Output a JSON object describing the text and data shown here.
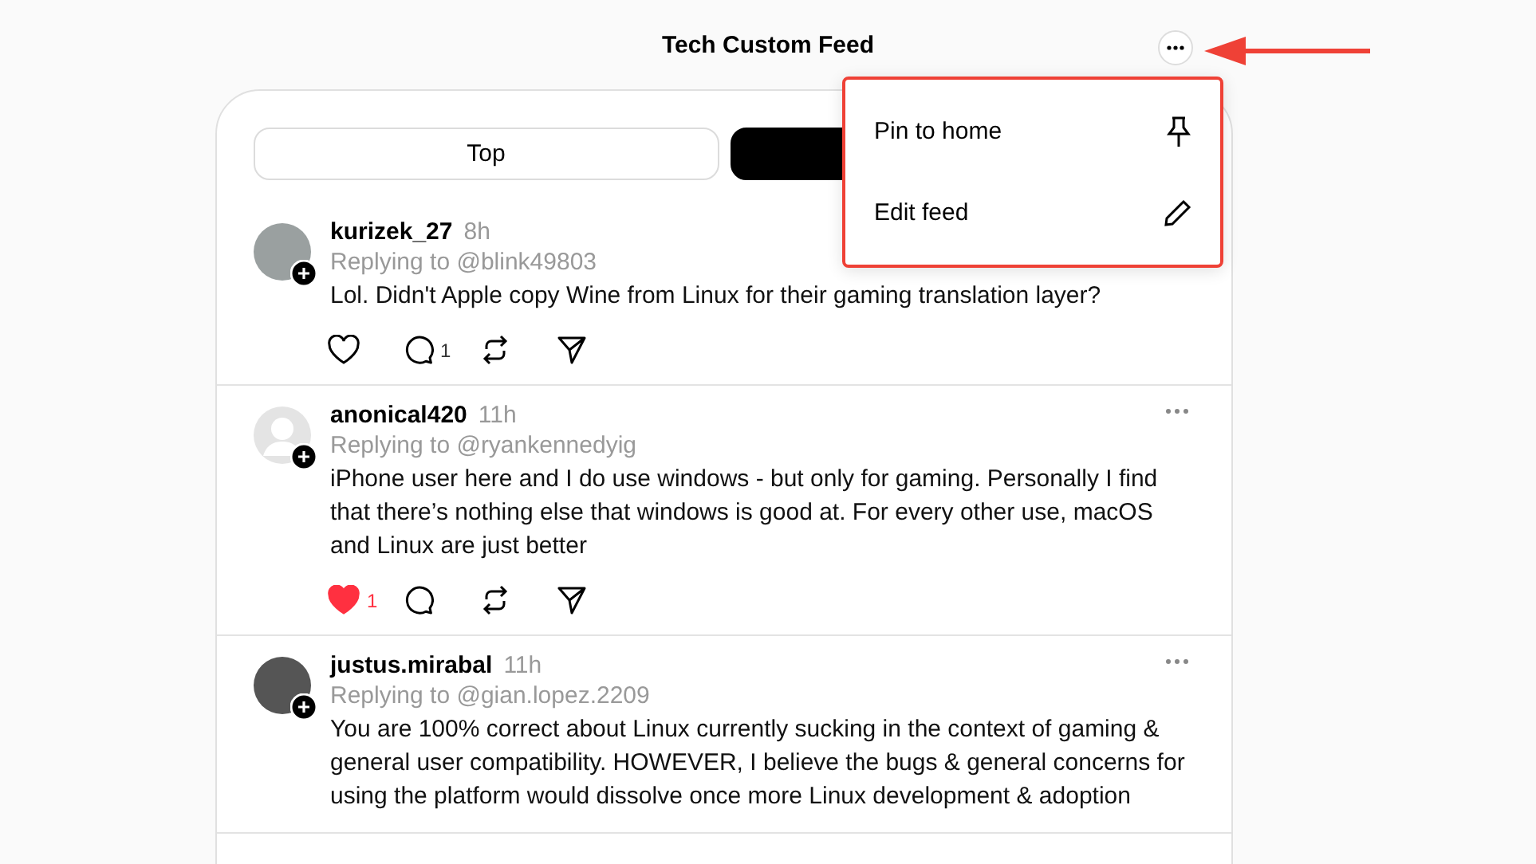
{
  "header": {
    "title": "Tech Custom Feed"
  },
  "tabs": [
    {
      "label": "Top",
      "selected": false
    },
    {
      "selected": true
    }
  ],
  "posts": [
    {
      "avatar": {
        "kind": "photo"
      },
      "username": "kurizek_27",
      "time": "8h",
      "replying_to": "Replying to @blink49803",
      "text": "Lol. Didn't Apple copy Wine from Linux for their gaming translation layer?",
      "actions": {
        "liked": false,
        "reply_count": "1"
      }
    },
    {
      "avatar": {
        "kind": "default"
      },
      "username": "anonical420",
      "time": "11h",
      "replying_to": "Replying to @ryankennedyig",
      "text": "iPhone user here and I do use windows - but only for gaming. Personally I find that there’s nothing else that windows is good at. For every other use, macOS and Linux are just better",
      "actions": {
        "liked": true,
        "like_count": "1"
      }
    },
    {
      "avatar": {
        "kind": "photo"
      },
      "username": "justus.mirabal",
      "time": "11h",
      "replying_to": "Replying to @gian.lopez.2209",
      "text": "You are 100% correct about Linux currently sucking in the context of gaming & general user compatibility. HOWEVER, I believe the bugs & general concerns for using the platform would dissolve once more Linux development & adoption"
    }
  ],
  "menu": {
    "items": [
      {
        "kind": "pin",
        "label": "Pin to home"
      },
      {
        "kind": "edit",
        "label": "Edit feed"
      }
    ]
  }
}
